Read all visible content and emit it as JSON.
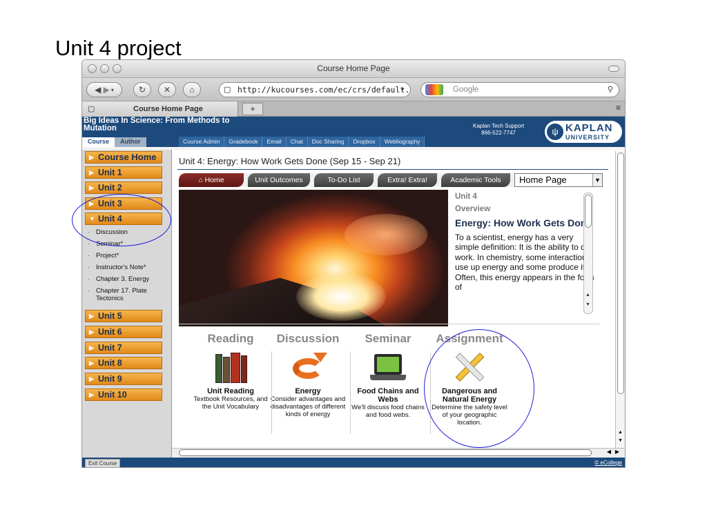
{
  "slide": {
    "title": "Unit 4 project"
  },
  "window": {
    "title": "Course Home Page"
  },
  "toolbar": {
    "back_icon": "back-arrow-icon",
    "url": "http://kucourses.com/ec/crs/default.l",
    "search_placeholder": "Google"
  },
  "tab": {
    "label": "Course Home Page",
    "new_tab": "+"
  },
  "lms": {
    "course_title": "Big Ideas In Science: From Methods to Mutation",
    "role_tabs": [
      "Course",
      "Author"
    ],
    "topnav": [
      "Course Admin",
      "Gradebook",
      "Email",
      "Chat",
      "Doc Sharing",
      "Dropbox",
      "Webliography"
    ],
    "support_line1": "Kaplan Tech Support",
    "support_line2": "866-522-7747",
    "brand_name": "KAPLAN",
    "brand_sub": "UNIVERSITY"
  },
  "sidebar": {
    "course_home": "Course Home",
    "units_top": [
      "Unit 1",
      "Unit 2",
      "Unit 3",
      "Unit 4"
    ],
    "unit4_items": [
      "Discussion",
      "Seminar*",
      "Project*",
      "Instructor's Note*",
      "Chapter 3. Energy",
      "Chapter 17. Plate Tectonics"
    ],
    "units_bottom": [
      "Unit 5",
      "Unit 6",
      "Unit 7",
      "Unit 8",
      "Unit 9",
      "Unit 10"
    ]
  },
  "content": {
    "heading": "Unit 4:  Energy: How Work Gets Done (Sep 15 - Sep 21)",
    "nav_tabs": [
      "Home",
      "Unit Outcomes",
      "To-Do List",
      "Extra! Extra!",
      "Academic Tools"
    ],
    "select_value": "Home Page",
    "overview": {
      "unit": "Unit 4",
      "label": "Overview",
      "title": "Energy: How Work Gets Done",
      "text": "To a scientist, energy has a very simple definition: It is the ability to do work. In chemistry, some interactions use up energy and some produce it. Often, this energy appears in the form of"
    },
    "columns": [
      {
        "head": "Reading",
        "title": "Unit Reading",
        "desc": "Textbook Resources, and the Unit Vocabulary",
        "icon": "books-icon"
      },
      {
        "head": "Discussion",
        "title": "Energy",
        "desc": "Consider advantages and disadvantages of different kinds of energy",
        "icon": "recycle-arrows-icon"
      },
      {
        "head": "Seminar",
        "title": "Food Chains and Webs",
        "desc": "We'll discuss food chains and food webs.",
        "icon": "laptop-icon"
      },
      {
        "head": "Assignment",
        "title": "Dangerous and Natural Energy",
        "desc": "Determine the safety level of your geographic location.",
        "icon": "pencil-ruler-icon"
      }
    ]
  },
  "footer": {
    "exit": "Exit Course",
    "brand": "© eCollege"
  },
  "colors": {
    "kaplan_blue": "#1d4a7c",
    "unit_orange": "#f0a030",
    "annotation_blue": "#1a1ad6"
  }
}
